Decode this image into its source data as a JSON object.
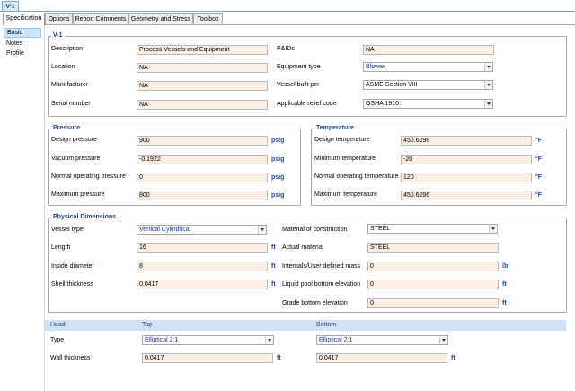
{
  "document_tab": "V-1",
  "tabs": [
    "Specification",
    "Options",
    "Report Comments",
    "Geometry and Stress",
    "Toolbox"
  ],
  "nav": [
    "Basic",
    "Notes",
    "Profile"
  ],
  "basic": {
    "title": "V-1",
    "description_label": "Description",
    "description_value": "Process Vessels and Equipment",
    "pids_label": "P&IDs",
    "pids_value": "NA",
    "location_label": "Location",
    "location_value": "NA",
    "equipment_type_label": "Equipment type",
    "equipment_type_value": "Blower",
    "manufacturer_label": "Manufacturer",
    "manufacturer_value": "NA",
    "vessel_built_per_label": "Vessel built per",
    "vessel_built_per_value": "ASME Section VIII",
    "serial_number_label": "Serial number",
    "serial_number_value": "NA",
    "relief_code_label": "Applicable relief code",
    "relief_code_value": "OSHA 1910"
  },
  "pressure": {
    "title": "Pressure",
    "design_label": "Design pressure",
    "design_value": "900",
    "vacuum_label": "Vacuum pressure",
    "vacuum_value": "-0.1922",
    "normal_label": "Normal operating pressure",
    "normal_value": "0",
    "max_label": "Maximum pressure",
    "max_value": "800",
    "unit": "psig"
  },
  "temperature": {
    "title": "Temperature",
    "design_label": "Design temperature",
    "design_value": "450.6296",
    "min_label": "Minimum temperature",
    "min_value": "-20",
    "normal_label": "Normal operating temperature",
    "normal_value": "120",
    "max_label": "Maximum temperature",
    "max_value": "450.6296",
    "unit": "°F"
  },
  "physical": {
    "title": "Physical Dimensions",
    "vessel_type_label": "Vessel type",
    "vessel_type_value": "Vertical Cylindrical",
    "material_label": "Material of construction",
    "material_value": "STEEL",
    "length_label": "Length",
    "length_value": "16",
    "actual_material_label": "Actual material",
    "actual_material_value": "STEEL",
    "inside_diameter_label": "Inside diameter",
    "inside_diameter_value": "8",
    "internals_mass_label": "Internals/User defined mass",
    "internals_mass_value": "0",
    "shell_thickness_label": "Shell thickness",
    "shell_thickness_value": "0.0417",
    "pool_bottom_label": "Liquid pool bottom elevation",
    "pool_bottom_value": "0",
    "grade_bottom_label": "Grade bottom elevation",
    "grade_bottom_value": "0",
    "unit_ft": "ft",
    "unit_lb": "lb"
  },
  "head": {
    "head_label": "Head",
    "top_label": "Top",
    "bottom_label": "Bottom",
    "type_label": "Type",
    "top_type_value": "Elliptical 2:1",
    "bottom_type_value": "Elliptical 2:1",
    "wall_thickness_label": "Wall thickness",
    "top_wall_value": "0.0417",
    "bottom_wall_value": "0.0417",
    "unit": "ft"
  },
  "colors": {
    "field_bg": "#fbeee3",
    "accent": "#1f3f7a",
    "unit": "#1f3fbf",
    "header_bar": "#cfe3f5",
    "selected_nav": "#cce4f7"
  }
}
